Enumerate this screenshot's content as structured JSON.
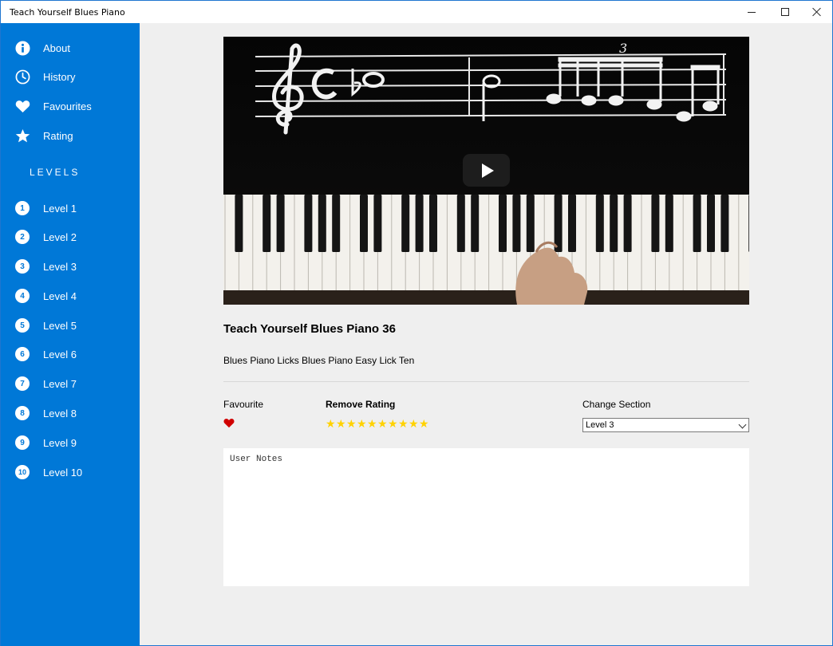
{
  "window": {
    "title": "Teach Yourself Blues Piano"
  },
  "sidebar": {
    "menu": [
      {
        "label": "About",
        "icon": "info-icon"
      },
      {
        "label": "History",
        "icon": "clock-icon"
      },
      {
        "label": "Favourites",
        "icon": "heart-icon"
      },
      {
        "label": "Rating",
        "icon": "star-icon"
      }
    ],
    "levels_heading": "LEVELS",
    "levels": [
      {
        "num": "1",
        "label": "Level 1"
      },
      {
        "num": "2",
        "label": "Level 2"
      },
      {
        "num": "3",
        "label": "Level 3"
      },
      {
        "num": "4",
        "label": "Level 4"
      },
      {
        "num": "5",
        "label": "Level 5"
      },
      {
        "num": "6",
        "label": "Level 6"
      },
      {
        "num": "7",
        "label": "Level 7"
      },
      {
        "num": "8",
        "label": "Level 8"
      },
      {
        "num": "9",
        "label": "Level 9"
      },
      {
        "num": "10",
        "label": "Level 10"
      }
    ]
  },
  "video": {
    "title": "Teach Yourself Blues Piano 36",
    "description": "Blues Piano Licks Blues Piano Easy Lick Ten",
    "tuplet_number": "3"
  },
  "controls": {
    "favourite_label": "Favourite",
    "favourite_active": true,
    "remove_rating_label": "Remove Rating",
    "rating_stars": 10,
    "rating_max": 10,
    "change_section_label": "Change Section",
    "section_selected": "Level 3"
  },
  "notes": {
    "placeholder": "User Notes"
  },
  "colors": {
    "sidebar": "#0078d7",
    "heart": "#d00000",
    "star": "#ffd200",
    "background": "#efefef"
  }
}
